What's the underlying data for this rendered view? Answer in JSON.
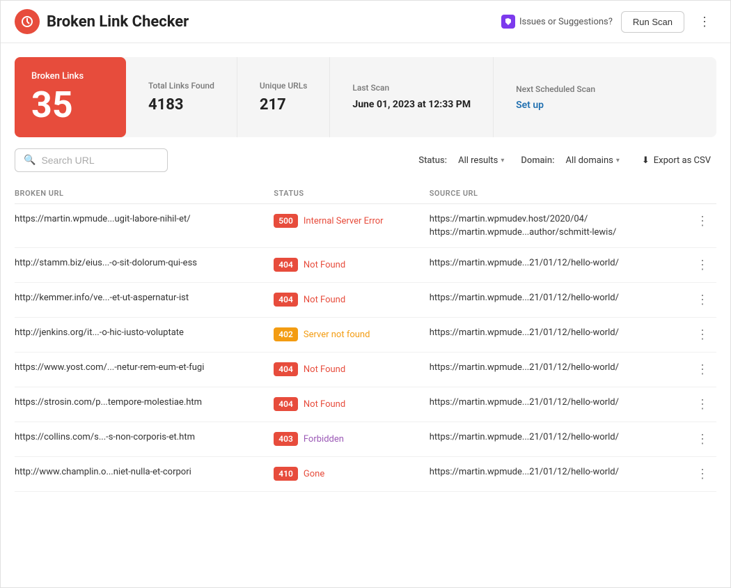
{
  "header": {
    "title": "Broken Link Checker",
    "issues_label": "Issues or Suggestions?",
    "run_scan_label": "Run Scan"
  },
  "stats": {
    "broken_links_label": "Broken Links",
    "broken_links_count": "35",
    "total_links_label": "Total Links Found",
    "total_links_value": "4183",
    "unique_urls_label": "Unique URLs",
    "unique_urls_value": "217",
    "last_scan_label": "Last Scan",
    "last_scan_value": "June 01, 2023 at 12:33 PM",
    "next_scan_label": "Next Scheduled Scan",
    "next_scan_link": "Set up"
  },
  "toolbar": {
    "search_placeholder": "Search URL",
    "status_label": "Status:",
    "status_value": "All results",
    "domain_label": "Domain:",
    "domain_value": "All domains",
    "export_label": "Export as CSV"
  },
  "table": {
    "col_broken_url": "BROKEN URL",
    "col_status": "STATUS",
    "col_source_url": "SOURCE URL",
    "rows": [
      {
        "broken_url": "https://martin.wpmude...ugit-labore-nihil-et/",
        "status_code": "500",
        "status_class": "status-500",
        "status_text": "Internal Server Error",
        "status_text_class": "status-text-red",
        "source_urls": [
          "https://martin.wpmudev.host/2020/04/",
          "https://martin.wpmude...author/schmitt-lewis/"
        ]
      },
      {
        "broken_url": "http://stamm.biz/eius...-o-sit-dolorum-qui-ess",
        "status_code": "404",
        "status_class": "status-404",
        "status_text": "Not Found",
        "status_text_class": "status-text-red",
        "source_urls": [
          "https://martin.wpmude...21/01/12/hello-world/"
        ]
      },
      {
        "broken_url": "http://kemmer.info/ve...-et-ut-aspernatur-ist",
        "status_code": "404",
        "status_class": "status-404",
        "status_text": "Not Found",
        "status_text_class": "status-text-red",
        "source_urls": [
          "https://martin.wpmude...21/01/12/hello-world/"
        ]
      },
      {
        "broken_url": "http://jenkins.org/it...-o-hic-iusto-voluptate",
        "status_code": "402",
        "status_class": "status-402",
        "status_text": "Server not found",
        "status_text_class": "status-text-orange",
        "source_urls": [
          "https://martin.wpmude...21/01/12/hello-world/"
        ]
      },
      {
        "broken_url": "https://www.yost.com/...-netur-rem-eum-et-fugi",
        "status_code": "404",
        "status_class": "status-404",
        "status_text": "Not Found",
        "status_text_class": "status-text-red",
        "source_urls": [
          "https://martin.wpmude...21/01/12/hello-world/"
        ]
      },
      {
        "broken_url": "https://strosin.com/p...tempore-molestiae.htm",
        "status_code": "404",
        "status_class": "status-404",
        "status_text": "Not Found",
        "status_text_class": "status-text-red",
        "source_urls": [
          "https://martin.wpmude...21/01/12/hello-world/"
        ]
      },
      {
        "broken_url": "https://collins.com/s...-s-non-corporis-et.htm",
        "status_code": "403",
        "status_class": "status-403",
        "status_text": "Forbidden",
        "status_text_class": "status-text-purple",
        "source_urls": [
          "https://martin.wpmude...21/01/12/hello-world/"
        ]
      },
      {
        "broken_url": "http://www.champlin.o...niet-nulla-et-corpori",
        "status_code": "410",
        "status_class": "status-410",
        "status_text": "Gone",
        "status_text_class": "status-text-red",
        "source_urls": [
          "https://martin.wpmude...21/01/12/hello-world/"
        ]
      }
    ]
  }
}
